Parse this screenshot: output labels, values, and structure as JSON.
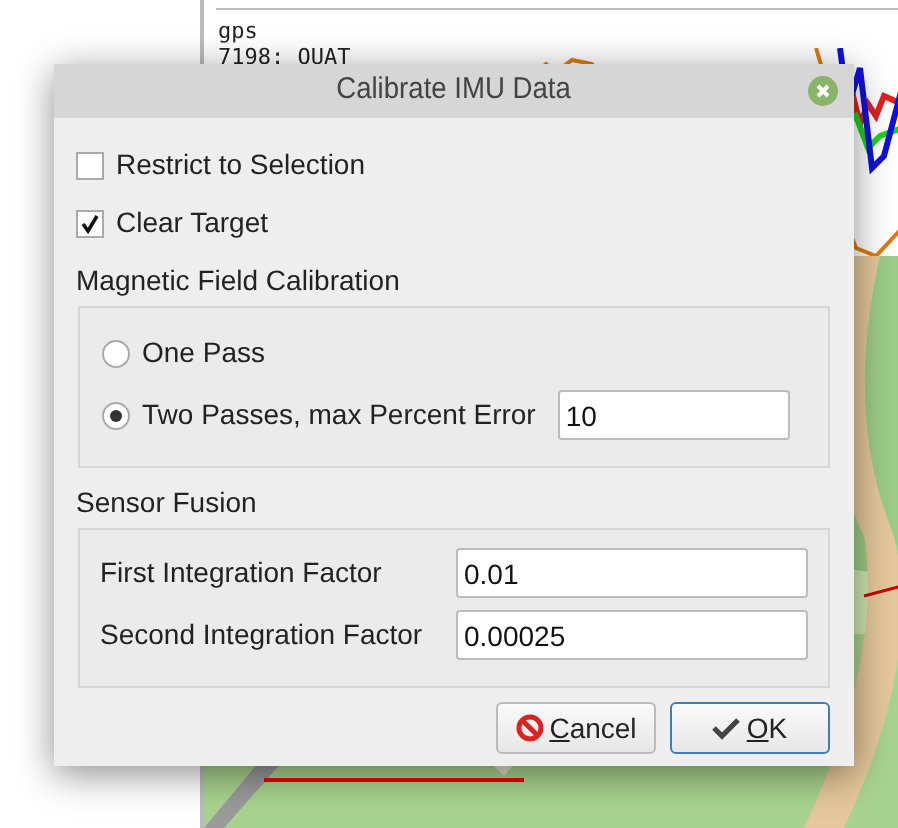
{
  "background": {
    "panel_label": "gps",
    "series_label": "7198: QUAT"
  },
  "window": {
    "title": "Calibrate IMU Data"
  },
  "options": [
    {
      "label": "Restrict to Selection",
      "checked": false
    },
    {
      "label": "Clear Target",
      "checked": true
    }
  ],
  "magnetic_field_calibration": {
    "title": "Magnetic Field Calibration",
    "choices": [
      {
        "label": "One Pass",
        "selected": false
      },
      {
        "label": "Two Passes, max Percent Error",
        "selected": true,
        "value": "10"
      }
    ]
  },
  "sensor_fusion": {
    "title": "Sensor Fusion",
    "fields": [
      {
        "label": "First Integration Factor",
        "value": "0.01"
      },
      {
        "label": "Second Integration Factor",
        "value": "0.00025"
      }
    ]
  },
  "buttons": [
    {
      "kind": "cancel",
      "mnemonic": "C",
      "rest": "ancel",
      "default": false
    },
    {
      "kind": "ok",
      "mnemonic": "O",
      "rest": "K",
      "default": true
    }
  ]
}
